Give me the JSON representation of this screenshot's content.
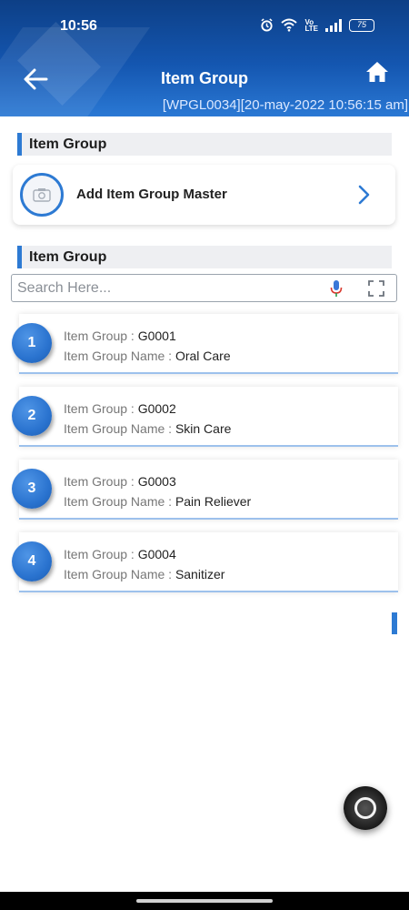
{
  "status_bar": {
    "time": "10:56",
    "battery": "75",
    "volte": "Vo LTE"
  },
  "header": {
    "title": "Item Group",
    "subtitle": "[WPGL0034][20-may-2022 10:56:15 am]"
  },
  "section_master": {
    "label": "Item Group"
  },
  "add_card": {
    "label": "Add Item Group Master"
  },
  "section_list": {
    "label": "Item Group"
  },
  "search": {
    "placeholder": "Search Here..."
  },
  "items": [
    {
      "num": "1",
      "group_key": "Item Group : ",
      "group": "G0001",
      "name_key": "Item Group Name : ",
      "name": "Oral Care"
    },
    {
      "num": "2",
      "group_key": "Item Group : ",
      "group": "G0002",
      "name_key": "Item Group Name : ",
      "name": "Skin Care"
    },
    {
      "num": "3",
      "group_key": "Item Group : ",
      "group": "G0003",
      "name_key": "Item Group Name : ",
      "name": "Pain Reliever"
    },
    {
      "num": "4",
      "group_key": "Item Group : ",
      "group": "G0004",
      "name_key": "Item Group Name : ",
      "name": "Sanitizer"
    }
  ],
  "colors": {
    "header_dark": "#0d3f86",
    "header_light": "#2a78d4",
    "accent": "#2d7ad3",
    "section_bg": "#eeeff2"
  },
  "icons": [
    "back-arrow-icon",
    "home-icon",
    "camera-icon",
    "chevron-right-icon",
    "microphone-icon",
    "scan-icon",
    "alarm-icon",
    "wifi-icon",
    "signal-icon",
    "battery-icon"
  ]
}
